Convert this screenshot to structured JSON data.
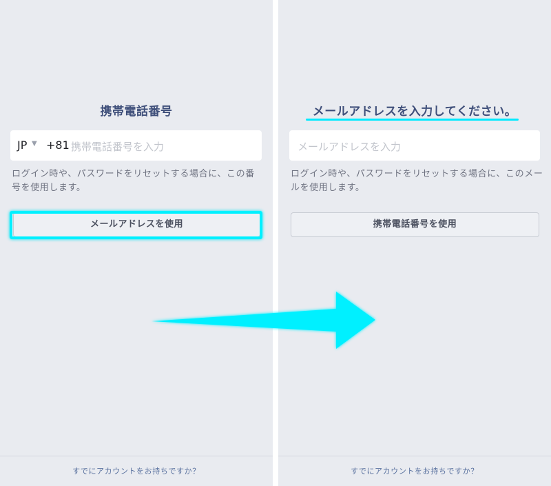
{
  "left_screen": {
    "title": "携帯電話番号",
    "country_code": "JP",
    "dial_prefix": "+81",
    "phone_placeholder": "携帯電話番号を入力",
    "note": "ログイン時や、パスワードをリセットする場合に、この番号を使用します。",
    "switch_button": "メールアドレスを使用",
    "footer_link": "すでにアカウントをお持ちですか？"
  },
  "right_screen": {
    "title": "メールアドレスを入力してください。",
    "email_placeholder": "メールアドレスを入力",
    "note": "ログイン時や、パスワードをリセットする場合に、このメールを使用します。",
    "switch_button": "携帯電話番号を使用",
    "footer_link": "すでにアカウントをお持ちですか？"
  },
  "annotation": {
    "highlight_color": "#00f0ff",
    "arrow_color": "#00f0ff"
  }
}
